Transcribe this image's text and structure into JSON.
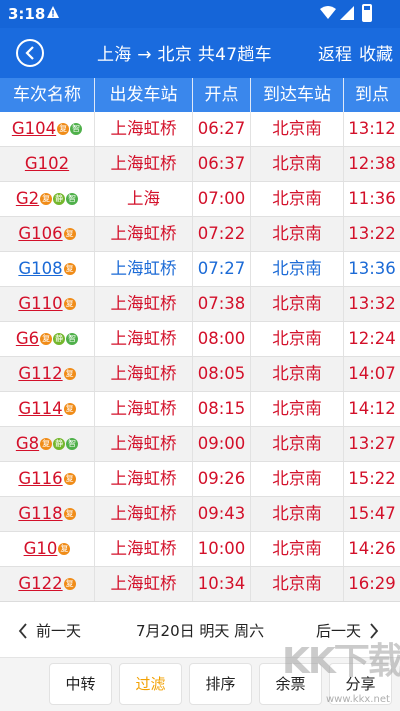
{
  "status_bar": {
    "time": "3:18"
  },
  "header": {
    "title": "上海 → 北京 共47趟车",
    "return_label": "返程",
    "favorite_label": "收藏"
  },
  "columns": [
    "车次名称",
    "出发车站",
    "开点",
    "到达车站",
    "到点"
  ],
  "trains": [
    {
      "code": "G104",
      "badges": [
        "复",
        "智"
      ],
      "from": "上海虹桥",
      "depart": "06:27",
      "to": "北京南",
      "arrive": "13:12",
      "color": "red"
    },
    {
      "code": "G102",
      "badges": [],
      "from": "上海虹桥",
      "depart": "06:37",
      "to": "北京南",
      "arrive": "12:38",
      "color": "red"
    },
    {
      "code": "G2",
      "badges": [
        "复",
        "静",
        "智"
      ],
      "from": "上海",
      "depart": "07:00",
      "to": "北京南",
      "arrive": "11:36",
      "color": "red"
    },
    {
      "code": "G106",
      "badges": [
        "复"
      ],
      "from": "上海虹桥",
      "depart": "07:22",
      "to": "北京南",
      "arrive": "13:22",
      "color": "red"
    },
    {
      "code": "G108",
      "badges": [
        "复"
      ],
      "from": "上海虹桥",
      "depart": "07:27",
      "to": "北京南",
      "arrive": "13:36",
      "color": "blue"
    },
    {
      "code": "G110",
      "badges": [
        "复"
      ],
      "from": "上海虹桥",
      "depart": "07:38",
      "to": "北京南",
      "arrive": "13:32",
      "color": "red"
    },
    {
      "code": "G6",
      "badges": [
        "复",
        "静",
        "智"
      ],
      "from": "上海虹桥",
      "depart": "08:00",
      "to": "北京南",
      "arrive": "12:24",
      "color": "red"
    },
    {
      "code": "G112",
      "badges": [
        "复"
      ],
      "from": "上海虹桥",
      "depart": "08:05",
      "to": "北京南",
      "arrive": "14:07",
      "color": "red"
    },
    {
      "code": "G114",
      "badges": [
        "复"
      ],
      "from": "上海虹桥",
      "depart": "08:15",
      "to": "北京南",
      "arrive": "14:12",
      "color": "red"
    },
    {
      "code": "G8",
      "badges": [
        "复",
        "静",
        "智"
      ],
      "from": "上海虹桥",
      "depart": "09:00",
      "to": "北京南",
      "arrive": "13:27",
      "color": "red"
    },
    {
      "code": "G116",
      "badges": [
        "复"
      ],
      "from": "上海虹桥",
      "depart": "09:26",
      "to": "北京南",
      "arrive": "15:22",
      "color": "red"
    },
    {
      "code": "G118",
      "badges": [
        "复"
      ],
      "from": "上海虹桥",
      "depart": "09:43",
      "to": "北京南",
      "arrive": "15:47",
      "color": "red"
    },
    {
      "code": "G10",
      "badges": [
        "复"
      ],
      "from": "上海虹桥",
      "depart": "10:00",
      "to": "北京南",
      "arrive": "14:26",
      "color": "red"
    },
    {
      "code": "G122",
      "badges": [
        "复"
      ],
      "from": "上海虹桥",
      "depart": "10:34",
      "to": "北京南",
      "arrive": "16:29",
      "color": "red"
    }
  ],
  "date_bar": {
    "prev_label": "前一天",
    "date_label": "7月20日 明天 周六",
    "next_label": "后一天"
  },
  "toolbar": {
    "transfer": "中转",
    "filter": "过滤",
    "sort": "排序",
    "tickets": "余票",
    "share": "分享"
  },
  "watermark": {
    "text": "KK下载",
    "url": "www.kkx.net"
  },
  "colors": {
    "header_bg": "#1a6bde",
    "column_header_bg": "#3a87ec",
    "train_red": "#d3102a",
    "train_blue": "#1b6ad6",
    "filter_active": "#f2a000"
  }
}
